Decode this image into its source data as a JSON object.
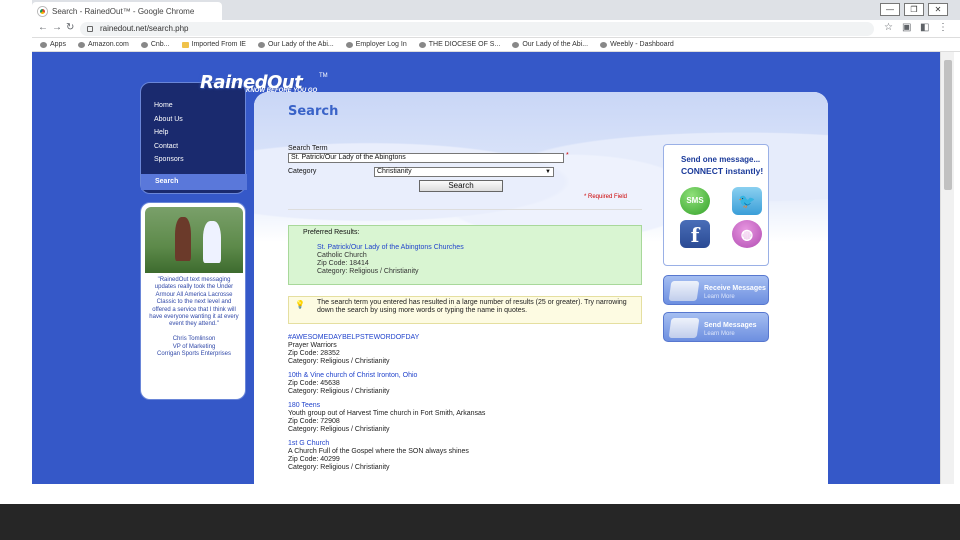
{
  "browser": {
    "tab_title": "Search - RainedOut™ - Google Chrome",
    "url": "rainedout.net/search.php",
    "window_controls": [
      "—",
      "❐",
      "✕"
    ],
    "bookmarks": [
      "Apps",
      "Amazon.com",
      "Cnb...",
      "Imported From IE",
      "Our Lady of the Abi...",
      "Employer Log In",
      "THE DIOCESE OF S...",
      "Our Lady of the Abi...",
      "Weebly - Dashboard"
    ]
  },
  "site": {
    "logo_text": "RainedOut",
    "logo_tm": "TM",
    "logo_tagline": "KNOW BEFORE YOU GO",
    "nav": [
      "Home",
      "About Us",
      "Help",
      "Contact",
      "Sponsors"
    ],
    "nav_active": "Search",
    "testimonial": {
      "quote": "\"RainedOut text messaging updates really took the Under Armour All America Lacrosse Classic to the next level and offered a service that I think will have everyone wanting it at every event they attend.\"",
      "author": "Chris Tomlinson",
      "role": "VP of Marketing",
      "company": "Corrigan Sports Enterprises"
    }
  },
  "search": {
    "title": "Search",
    "term_label": "Search Term",
    "term_value": "St. Patrick/Our Lady of the Abingtons",
    "category_label": "Category",
    "category_value": "Christianity",
    "button": "Search",
    "required_note": "* Required Field",
    "required_star": "*"
  },
  "preferred": {
    "title": "Preferred Results:",
    "link": "St. Patrick/Our Lady of the Abingtons Churches",
    "type": "Catholic Church",
    "zip": "Zip Code: 18414",
    "category": "Category: Religious / Christianity"
  },
  "notice": {
    "icon": "lightbulb-icon",
    "text": "The search term you entered has resulted in a large number of results (25 or greater). Try narrowing down the search by using more words or typing the name in quotes."
  },
  "results": [
    {
      "title": "#AWESOMEDAYBELPSTEWORDOFDAY",
      "line1": "Prayer Warriors",
      "line2": "Zip Code: 28352",
      "line3": "Category: Religious / Christianity"
    },
    {
      "title": "10th & Vine church of Christ Ironton, Ohio",
      "line1": "Zip Code: 45638",
      "line2": "Category: Religious / Christianity",
      "line3": ""
    },
    {
      "title": "180 Teens",
      "line1": "Youth group out of Harvest Time church in Fort Smith, Arkansas",
      "line2": "Zip Code: 72908",
      "line3": "Category: Religious / Christianity"
    },
    {
      "title": "1st G Church",
      "line1": "A Church Full of the Gospel where the SON always shines",
      "line2": "Zip Code: 40299",
      "line3": "Category: Religious / Christianity"
    }
  ],
  "sidebar": {
    "connect_line1": "Send one message...",
    "connect_line2": "CONNECT instantly!",
    "sms_label": "SMS",
    "facebook_label": "f",
    "receive_label": "Receive Messages",
    "receive_sub": "Learn More",
    "send_label": "Send Messages",
    "send_sub": "Learn More"
  }
}
